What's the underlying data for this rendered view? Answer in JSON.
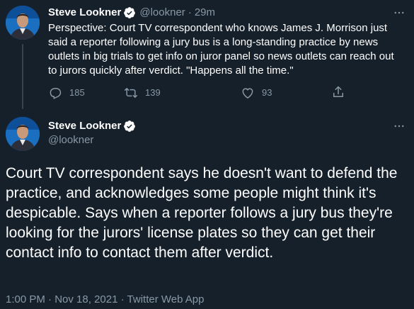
{
  "tweet1": {
    "display_name": "Steve Lookner",
    "handle": "@lookner",
    "separator": "·",
    "time": "29m",
    "text": "Perspective: Court TV correspondent who knows James J. Morrison just said a reporter following a jury bus is a long-standing practice by news outlets in big trials to get info on juror panel so news outlets can reach out to jurors quickly after verdict. \"Happens all the time.\"",
    "actions": {
      "reply_count": "185",
      "retweet_count": "139",
      "like_count": "93"
    }
  },
  "tweet2": {
    "display_name": "Steve Lookner",
    "handle": "@lookner",
    "text": "Court TV correspondent says he doesn't want to defend the practice, and acknowledges some people might think it's despicable. Says when a reporter follows a jury bus they're looking for the jurors' license plates so they can get their contact info to contact them after verdict.",
    "time": "1:00 PM",
    "date": "Nov 18, 2021",
    "source": "Twitter Web App",
    "separator": "·"
  },
  "icons": {
    "verified": "verified-badge-icon",
    "more": "more-horizontal-icon",
    "reply": "reply-icon",
    "retweet": "retweet-icon",
    "like": "heart-icon",
    "share": "share-icon"
  },
  "colors": {
    "background": "#15202b",
    "text": "#ffffff",
    "muted": "#8899a6",
    "accent": "#1da1f2",
    "thread_line": "#38444d"
  }
}
